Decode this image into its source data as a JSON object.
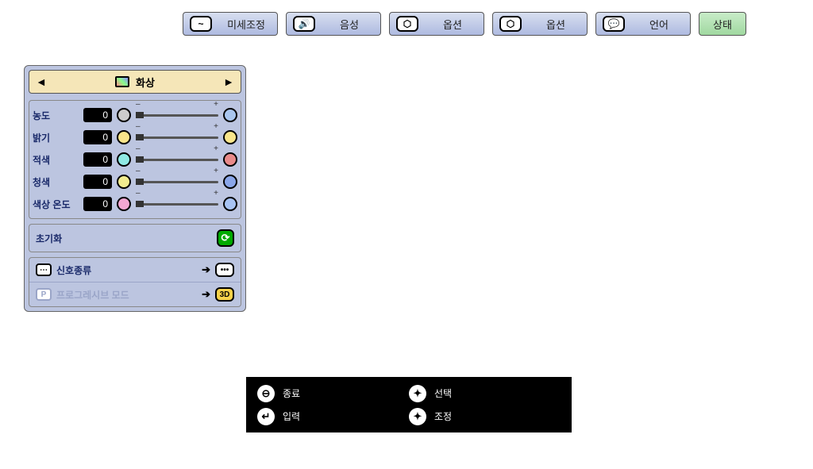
{
  "tabs": [
    {
      "label": "미세조정",
      "icon": "~"
    },
    {
      "label": "음성",
      "icon": "🔊"
    },
    {
      "label": "옵션",
      "icon": "⬡"
    },
    {
      "label": "옵션",
      "icon": "⬡"
    },
    {
      "label": "언어",
      "icon": "💬"
    },
    {
      "label": "상태",
      "icon": ""
    }
  ],
  "menu": {
    "title": "화상",
    "sliders": [
      {
        "label": "농도",
        "value": "0",
        "leftColor": "#cccccc",
        "rightColor": "#a9c6ef"
      },
      {
        "label": "밝기",
        "value": "0",
        "leftColor": "#f9e58b",
        "rightColor": "#f9e58b"
      },
      {
        "label": "적색",
        "value": "0",
        "leftColor": "#8fe9e4",
        "rightColor": "#e98a8a"
      },
      {
        "label": "청색",
        "value": "0",
        "leftColor": "#f1ec8f",
        "rightColor": "#8aa6e9"
      },
      {
        "label": "색상 온도",
        "value": "0",
        "leftColor": "#f4a7d3",
        "rightColor": "#a7c3f4"
      }
    ],
    "reset": "초기화",
    "options": [
      {
        "label": "신호종류",
        "end": "•••"
      },
      {
        "label": "프로그레시브 모드",
        "end": "3D",
        "disabled": true
      }
    ]
  },
  "bottom": [
    {
      "label": "종료",
      "icon": "⊖"
    },
    {
      "label": "선택",
      "icon": "✦"
    },
    {
      "label": "입력",
      "icon": "↵"
    },
    {
      "label": "조정",
      "icon": "✦"
    }
  ]
}
